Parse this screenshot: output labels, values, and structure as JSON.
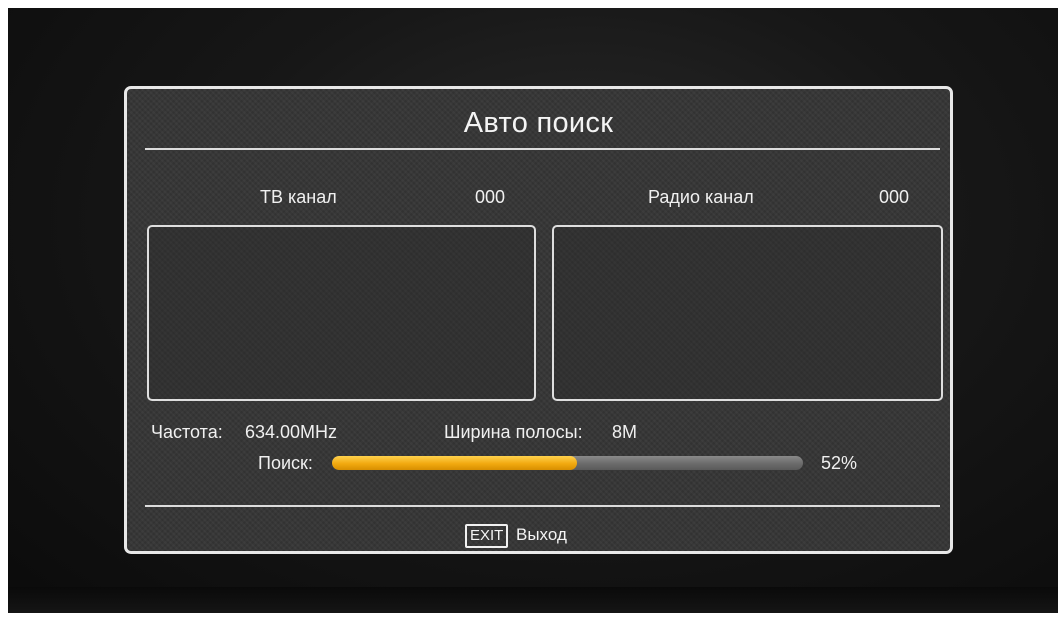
{
  "dialog": {
    "title": "Авто поиск",
    "tv_channel_label": "ТВ канал",
    "tv_channel_count": "000",
    "radio_channel_label": "Радио канал",
    "radio_channel_count": "000",
    "frequency_label": "Частота:",
    "frequency_value": "634.00MHz",
    "bandwidth_label": "Ширина полосы:",
    "bandwidth_value": "8M",
    "search_label": "Поиск:",
    "progress_text": "52%",
    "progress_fraction": 0.52,
    "exit_key": "EXIT",
    "exit_label": "Выход"
  },
  "colors": {
    "progress_fill": "#f2a90f",
    "progress_track": "#6b6b6b",
    "dialog_background": "#343434",
    "border": "#e8e8e8"
  }
}
